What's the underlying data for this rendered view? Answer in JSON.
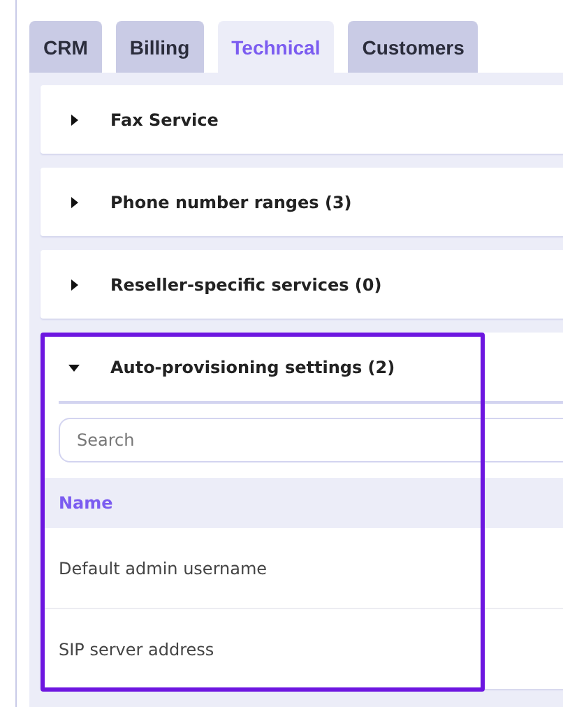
{
  "tabs": [
    {
      "label": "CRM",
      "selected": false
    },
    {
      "label": "Billing",
      "selected": false
    },
    {
      "label": "Technical",
      "selected": true
    },
    {
      "label": "Customers",
      "selected": false
    }
  ],
  "sections": [
    {
      "title": "Fax Service",
      "expanded": false,
      "highlighted": false
    },
    {
      "title": "Phone number ranges (3)",
      "expanded": false,
      "highlighted": false
    },
    {
      "title": "Reseller-specific services (0)",
      "expanded": false,
      "highlighted": false
    },
    {
      "title": "Auto-provisioning settings (2)",
      "expanded": true,
      "highlighted": true,
      "search": {
        "placeholder": "Search"
      },
      "table": {
        "columns": [
          "Name"
        ],
        "rows": [
          [
            "Default admin username"
          ],
          [
            "SIP server address"
          ]
        ]
      }
    }
  ]
}
